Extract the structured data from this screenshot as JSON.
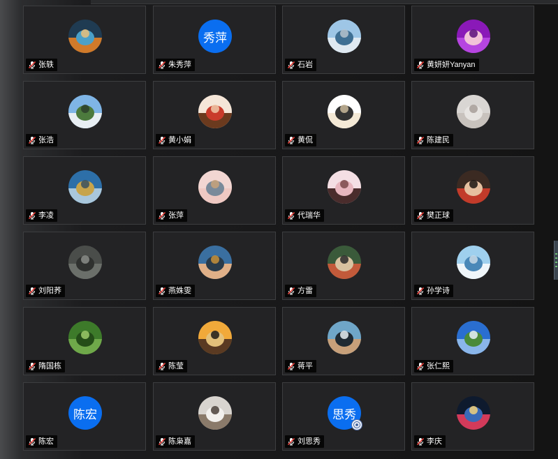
{
  "participants": [
    {
      "name": "张轶",
      "avatar_type": "photo",
      "avatar_icon": "vertebra-photo",
      "colors": [
        "#1f3b52",
        "#d07a2a",
        "#4aa0c8",
        "#e9c07a"
      ]
    },
    {
      "name": "朱秀萍",
      "avatar_type": "text",
      "avatar_text": "秀萍",
      "bg": "#0a6ef0"
    },
    {
      "name": "石岩",
      "avatar_type": "photo",
      "avatar_icon": "seaside-photo",
      "colors": [
        "#9ec6e6",
        "#dfe9f1",
        "#3f6f93",
        "#b6c3cc"
      ]
    },
    {
      "name": "黄妍妍Yanyan",
      "avatar_type": "photo",
      "avatar_icon": "cartoon-girl-photo",
      "colors": [
        "#8a19b8",
        "#b645e0",
        "#f2c2d8",
        "#5b0f7c"
      ]
    },
    {
      "name": "张浩",
      "avatar_type": "photo",
      "avatar_icon": "house-photo",
      "colors": [
        "#7fb5e6",
        "#e8eef3",
        "#4c7a3d",
        "#2d3f2a"
      ]
    },
    {
      "name": "黄小娟",
      "avatar_type": "photo",
      "avatar_icon": "illustrated-girl-photo",
      "colors": [
        "#f5e6d8",
        "#6b3a1e",
        "#c93b2b",
        "#f0c9a8"
      ]
    },
    {
      "name": "黄侃",
      "avatar_type": "photo",
      "avatar_icon": "cartoon-bun-photo",
      "colors": [
        "#ffffff",
        "#f4e9d6",
        "#333333",
        "#c9b89a"
      ]
    },
    {
      "name": "陈建民",
      "avatar_type": "photo",
      "avatar_icon": "flower-photo",
      "colors": [
        "#d9d6d3",
        "#c8c2bd",
        "#e7e4e1",
        "#a79f99"
      ]
    },
    {
      "name": "李凌",
      "avatar_type": "photo",
      "avatar_icon": "mountain-lake-photo",
      "colors": [
        "#2d6fa8",
        "#a9c7dc",
        "#c7a44b",
        "#38515f"
      ]
    },
    {
      "name": "张萍",
      "avatar_type": "photo",
      "avatar_icon": "bird-photo",
      "colors": [
        "#f2d6d2",
        "#efc9c3",
        "#7a8a9a",
        "#c8a27a"
      ]
    },
    {
      "name": "代瑞华",
      "avatar_type": "photo",
      "avatar_icon": "anime-girl-photo",
      "colors": [
        "#f4dfe4",
        "#4a2c2c",
        "#e8b7bf",
        "#7a4a4a"
      ]
    },
    {
      "name": "樊正球",
      "avatar_type": "photo",
      "avatar_icon": "child-photo",
      "colors": [
        "#3b2a22",
        "#c23b2a",
        "#e6c0a0",
        "#1b1512"
      ]
    },
    {
      "name": "刘阳荞",
      "avatar_type": "photo",
      "avatar_icon": "tree-photo",
      "colors": [
        "#4a4d4a",
        "#6b6f6a",
        "#2f312f",
        "#8a8d88"
      ]
    },
    {
      "name": "燕姝雯",
      "avatar_type": "photo",
      "avatar_icon": "boy-photo",
      "colors": [
        "#3a6fa0",
        "#e0b088",
        "#2a3b4a",
        "#c7923a"
      ]
    },
    {
      "name": "方雷",
      "avatar_type": "photo",
      "avatar_icon": "dog-photo",
      "colors": [
        "#3a5a3a",
        "#c25a3a",
        "#d8c2a0",
        "#2a2a2a"
      ]
    },
    {
      "name": "孙学诗",
      "avatar_type": "photo",
      "avatar_icon": "beach-person-photo",
      "colors": [
        "#9fd0ee",
        "#f0f6fa",
        "#4a88b8",
        "#c9dbe6"
      ]
    },
    {
      "name": "隋国栋",
      "avatar_type": "photo",
      "avatar_icon": "green-tree-photo",
      "colors": [
        "#3d7a2a",
        "#6fa84a",
        "#244d18",
        "#9ccb6a"
      ]
    },
    {
      "name": "陈莹",
      "avatar_type": "photo",
      "avatar_icon": "sunset-photo",
      "colors": [
        "#f1a93a",
        "#5a3a22",
        "#e3c07a",
        "#1f1a18"
      ]
    },
    {
      "name": "蒋平",
      "avatar_type": "photo",
      "avatar_icon": "man-sunglasses-photo",
      "colors": [
        "#6fa6c8",
        "#c7a07a",
        "#1f2a33",
        "#e7eef2"
      ]
    },
    {
      "name": "张仁熙",
      "avatar_type": "photo",
      "avatar_icon": "sky-field-photo",
      "colors": [
        "#2a6ed0",
        "#8ab6ea",
        "#4a8a3a",
        "#e9f1fb"
      ]
    },
    {
      "name": "陈宏",
      "avatar_type": "text",
      "avatar_text": "陈宏",
      "bg": "#0a6ef0"
    },
    {
      "name": "陈枭嘉",
      "avatar_type": "photo",
      "avatar_icon": "animal-photo",
      "colors": [
        "#d8d4cf",
        "#8a7a6a",
        "#f2f0ed",
        "#4a4038"
      ]
    },
    {
      "name": "刘思秀",
      "avatar_type": "text",
      "avatar_text": "思秀",
      "bg": "#0a6ef0",
      "badge": true,
      "badge_icon": "emblem-icon"
    },
    {
      "name": "李庆",
      "avatar_type": "photo",
      "avatar_icon": "city-night-photo",
      "colors": [
        "#0e1a2e",
        "#d23a5a",
        "#3a6ab8",
        "#f2d07a"
      ]
    }
  ]
}
